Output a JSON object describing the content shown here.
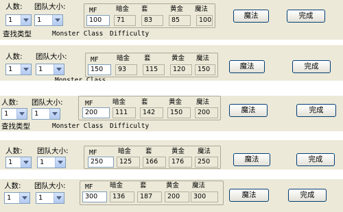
{
  "labels": {
    "count": "人数:",
    "team_size": "团队大小:",
    "search_type": "查找类型",
    "monster_class": "Monster Class",
    "difficulty": "Difficulty"
  },
  "headers": {
    "mf": "MF",
    "dark_gold": "暗金",
    "set": "套",
    "gold": "黄金",
    "magic": "魔法"
  },
  "buttons": {
    "magic": "魔法",
    "done": "完成"
  },
  "rows": [
    {
      "count": "1",
      "team_size": "1",
      "mf": "100",
      "dark_gold": "71",
      "set": "83",
      "gold": "85",
      "magic": "100"
    },
    {
      "count": "1",
      "team_size": "1",
      "mf": "150",
      "dark_gold": "93",
      "set": "115",
      "gold": "120",
      "magic": "150"
    },
    {
      "count": "1",
      "team_size": "1",
      "mf": "200",
      "dark_gold": "111",
      "set": "142",
      "gold": "150",
      "magic": "200"
    },
    {
      "count": "1",
      "team_size": "1",
      "mf": "250",
      "dark_gold": "125",
      "set": "166",
      "gold": "176",
      "magic": "250"
    },
    {
      "count": "1",
      "team_size": "1",
      "mf": "300",
      "dark_gold": "136",
      "set": "187",
      "gold": "200",
      "magic": "300"
    }
  ]
}
